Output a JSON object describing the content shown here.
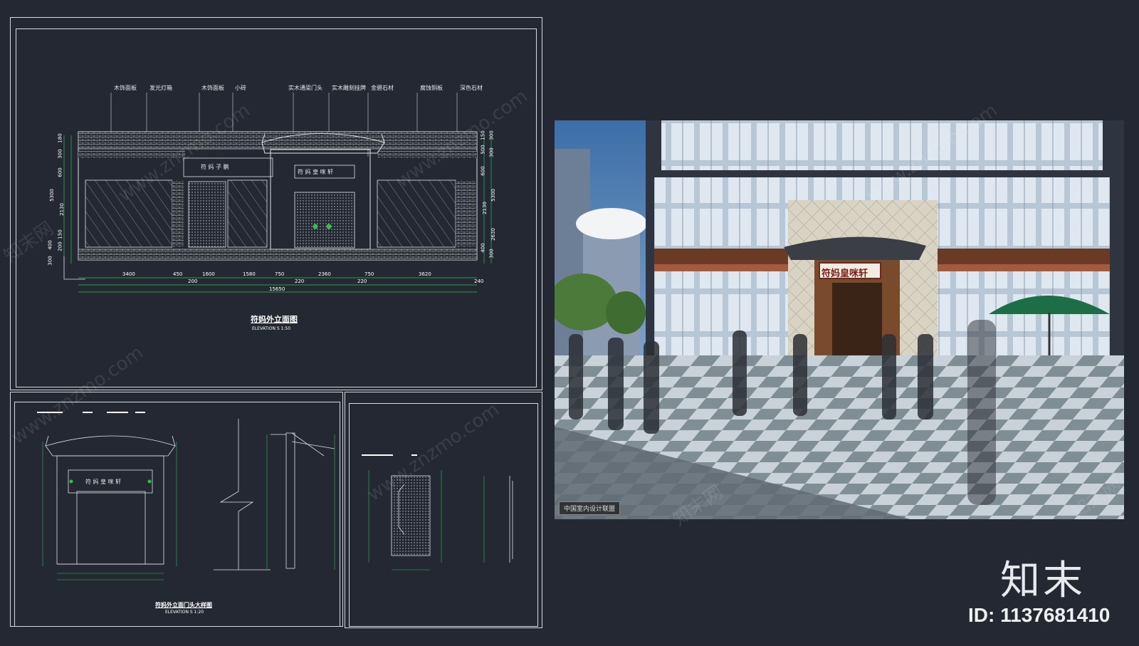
{
  "elevation": {
    "labels": [
      "木饰面板",
      "发光灯箱",
      "木饰面板",
      "小砖",
      "实木通梁门头",
      "实木雕刻挂牌",
      "金碧石材",
      "腐蚀铜板",
      "深色石材"
    ],
    "sign_left": "符  妈  子  鹏",
    "sign_center": "符  妈  皇  咪  轩",
    "dims_bottom": [
      "3400",
      "450",
      "1600",
      "1580",
      "750",
      "2360",
      "750",
      "3620"
    ],
    "dims_bottom2": [
      "200",
      "220",
      "220",
      "240"
    ],
    "dims_total": "15650",
    "dims_left": [
      "180",
      "300",
      "600",
      "2130",
      "150",
      "200"
    ],
    "dims_left2": [
      "5300",
      "400",
      "300"
    ],
    "dims_right": [
      "150",
      "300",
      "500",
      "300",
      "600",
      "2130",
      "2630",
      "5300",
      "400",
      "300"
    ],
    "title": "符妈外立面图",
    "subtitle": "ELEVATION   S 1:50"
  },
  "detail": {
    "sign": "符  妈  皇  咪  轩",
    "title": "符妈外立面门头大样图",
    "subtitle": "ELEVATION   S 1:20"
  },
  "render": {
    "sign": "符妈皇咪轩",
    "caption": "中国室内设计联盟"
  },
  "watermark": "www.znzmo.com",
  "watermark_cn": "知末网",
  "brand": "知末",
  "id_text": "ID: 1137681410",
  "colors": {
    "background": "#232833",
    "frame": "#d8dadd",
    "dimension_line": "#2ec24a"
  }
}
